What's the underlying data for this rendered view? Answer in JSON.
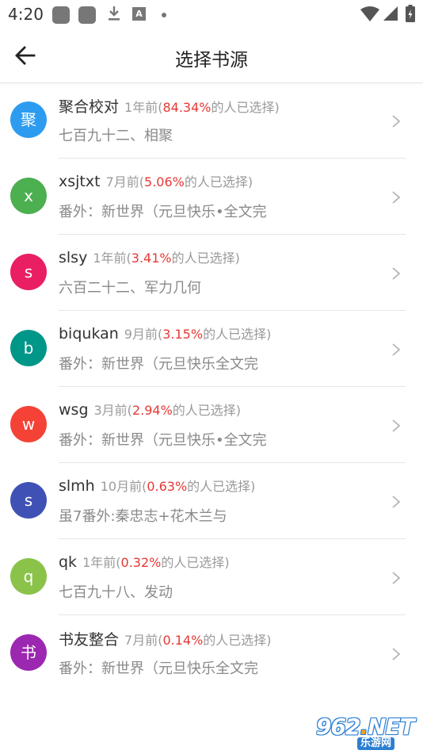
{
  "status_bar": {
    "time": "4:20",
    "icons": [
      "notification-square-icon",
      "notification-square-icon",
      "download-icon",
      "a-box-icon",
      "dot-icon",
      "wifi-icon",
      "signal-icon",
      "battery-charging-icon"
    ],
    "a_icon_text": "A"
  },
  "app_bar": {
    "title": "选择书源",
    "back_icon": "arrow-left-icon"
  },
  "colors": {
    "percentage": "#e53935",
    "meta": "#9a9a9a",
    "chapter": "#8a8a8a"
  },
  "sources": [
    {
      "avatar": "聚",
      "color": "#2d9cf0",
      "name": "聚合校对",
      "time": "1年前(",
      "pct": "84.34%",
      "suffix": "的人已选择)",
      "chapter": "七百九十二、相聚"
    },
    {
      "avatar": "x",
      "color": "#4caf50",
      "name": "xsjtxt",
      "time": "7月前(",
      "pct": "5.06%",
      "suffix": "的人已选择)",
      "chapter": "番外：新世界（元旦快乐•全文完"
    },
    {
      "avatar": "s",
      "color": "#e91e63",
      "name": "slsy",
      "time": "1年前(",
      "pct": "3.41%",
      "suffix": "的人已选择)",
      "chapter": "六百二十二、军力几何"
    },
    {
      "avatar": "b",
      "color": "#009688",
      "name": "biqukan",
      "time": "9月前(",
      "pct": "3.15%",
      "suffix": "的人已选择)",
      "chapter": "番外：新世界（元旦快乐全文完"
    },
    {
      "avatar": "w",
      "color": "#f44336",
      "name": "wsg",
      "time": "3月前(",
      "pct": "2.94%",
      "suffix": "的人已选择)",
      "chapter": "番外：新世界（元旦快乐•全文完"
    },
    {
      "avatar": "s",
      "color": "#3f51b5",
      "name": "slmh",
      "time": "10月前(",
      "pct": "0.63%",
      "suffix": "的人已选择)",
      "chapter": "虽7番外:秦忠志+花木兰与"
    },
    {
      "avatar": "q",
      "color": "#8bc34a",
      "name": "qk",
      "time": "1年前(",
      "pct": "0.32%",
      "suffix": "的人已选择)",
      "chapter": "七百九十八、发动"
    },
    {
      "avatar": "书",
      "color": "#9c27b0",
      "name": "书友整合",
      "time": "7月前(",
      "pct": "0.14%",
      "suffix": "的人已选择)",
      "chapter": "番外：新世界（元旦快乐全文完"
    }
  ],
  "watermark": {
    "main_left": "962",
    "main_dot": ".",
    "main_right": "NET",
    "sub": "乐游网"
  }
}
